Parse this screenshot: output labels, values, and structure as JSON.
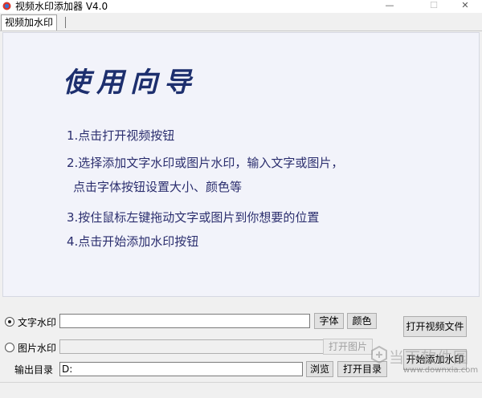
{
  "window": {
    "title": "视频水印添加器 V4.0",
    "minimize": "—",
    "maximize": "☐",
    "close": "✕"
  },
  "tabs": [
    {
      "label": "视频加水印",
      "active": true
    }
  ],
  "guide": {
    "title": "使用向导",
    "steps": [
      "1.点击打开视频按钮",
      "2.选择添加文字水印或图片水印，输入文字或图片，",
      "点击字体按钮设置大小、颜色等",
      "3.按住鼠标左键拖动文字或图片到你想要的位置",
      "4.点击开始添加水印按钮"
    ]
  },
  "controls": {
    "text_watermark": {
      "label": "文字水印",
      "selected": true,
      "value": ""
    },
    "image_watermark": {
      "label": "图片水印",
      "selected": false,
      "value": ""
    },
    "font_button": "字体",
    "color_button": "颜色",
    "open_image_button": "打开图片",
    "output_dir_label": "输出目录",
    "output_dir_value": "D:",
    "browse_button": "浏览",
    "open_dir_button": "打开目录",
    "open_video_button": "打开视频文件",
    "start_button": "开始添加水印"
  },
  "watermark_overlay": {
    "text": "当下软件园",
    "url": "www.downxia.com"
  },
  "colors": {
    "guide_text": "#2b2e6e",
    "guide_title": "#1d2f6e",
    "panel_bg": "#f2f3fa"
  }
}
